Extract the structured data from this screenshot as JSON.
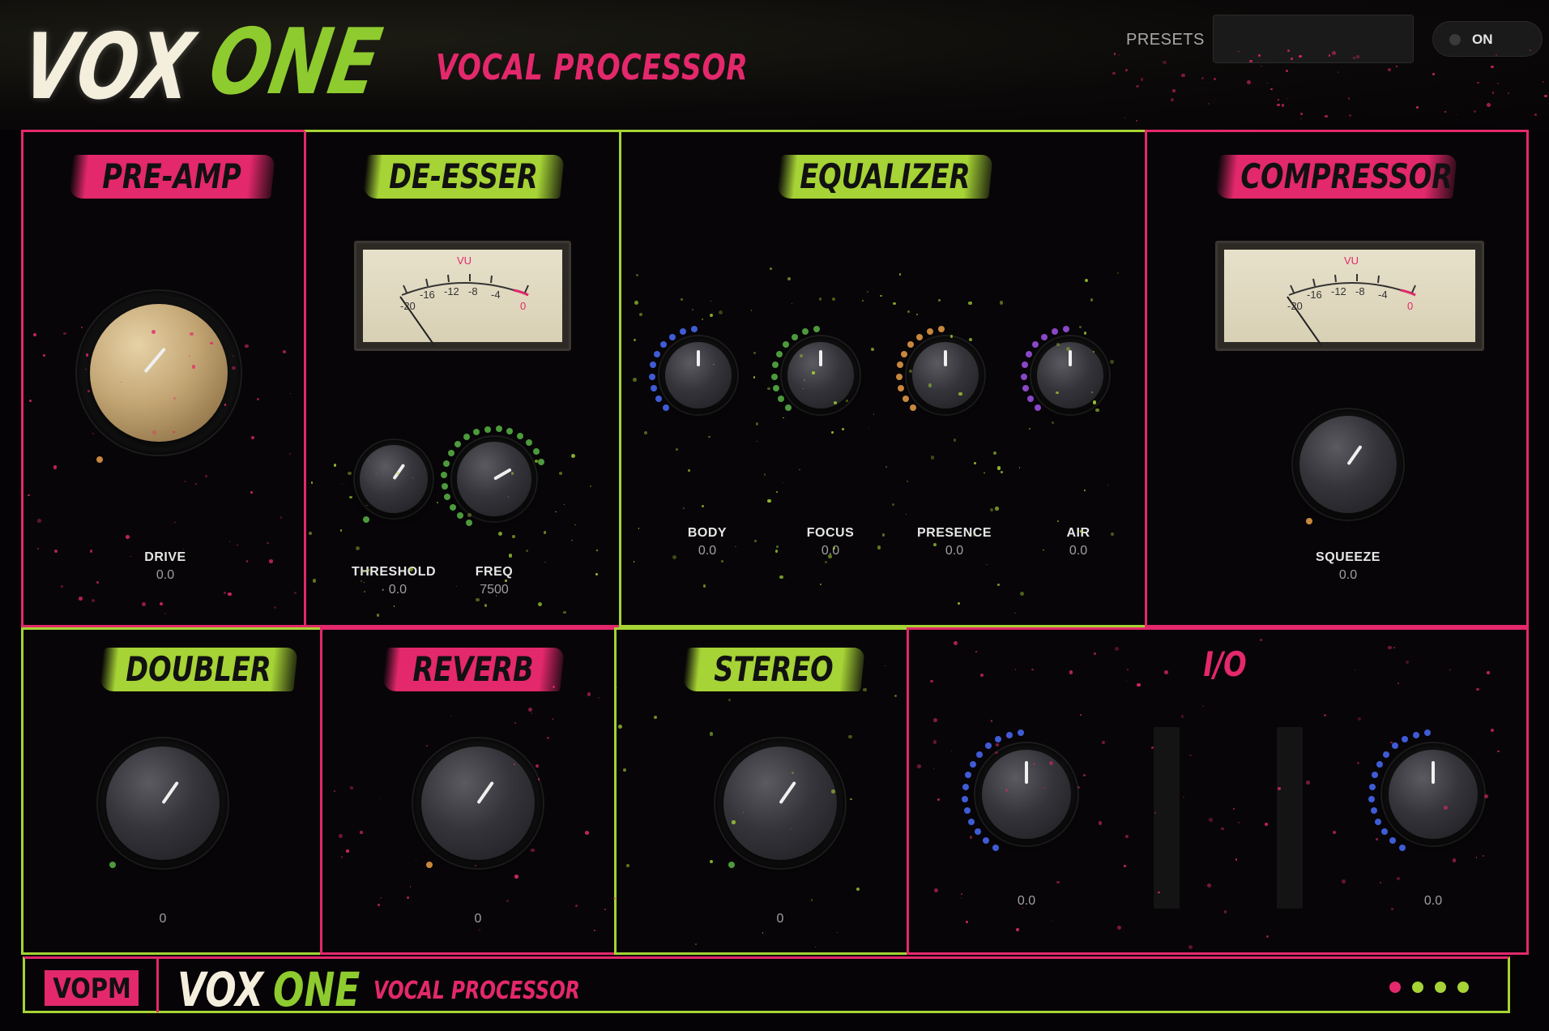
{
  "header": {
    "logo_vox": "VOX",
    "logo_one": "ONE",
    "logo_sub": "VOCAL PROCESSOR",
    "presets_label": "PRESETS",
    "preset_value": "",
    "power_label": "ON"
  },
  "colors": {
    "pink": "#e3286b",
    "green": "#a6d335",
    "blue": "#3f5cd6",
    "eq_green": "#4c9a3c",
    "orange": "#c7873e",
    "purple": "#8a47c8"
  },
  "preamp": {
    "title": "PRE-AMP",
    "drive_label": "DRIVE",
    "drive_value": "0.0"
  },
  "deesser": {
    "title": "DE-ESSER",
    "vu": {
      "label": "VU",
      "ticks": [
        "-20",
        "-16",
        "-12",
        "-8",
        "-4",
        "0"
      ]
    },
    "threshold_label": "THRESHOLD",
    "threshold_value": "· 0.0",
    "freq_label": "FREQ",
    "freq_value": "7500"
  },
  "equalizer": {
    "title": "EQUALIZER",
    "bands": [
      {
        "label": "BODY",
        "value": "0.0"
      },
      {
        "label": "FOCUS",
        "value": "0.0"
      },
      {
        "label": "PRESENCE",
        "value": "0.0"
      },
      {
        "label": "AIR",
        "value": "0.0"
      }
    ]
  },
  "compressor": {
    "title": "COMPRESSOR",
    "vu": {
      "label": "VU",
      "ticks": [
        "-20",
        "-16",
        "-12",
        "-8",
        "-4",
        "0"
      ]
    },
    "squeeze_label": "SQUEEZE",
    "squeeze_value": "0.0"
  },
  "doubler": {
    "title": "DOUBLER",
    "value": "0"
  },
  "reverb": {
    "title": "REVERB",
    "value": "0"
  },
  "stereo": {
    "title": "STEREO",
    "value": "0"
  },
  "io": {
    "title": "I/O",
    "input_value": "0.0",
    "output_value": "0.0"
  },
  "footer": {
    "badge": "VOPM",
    "vox": "VOX",
    "one": "ONE",
    "sub": "VOCAL PROCESSOR"
  }
}
